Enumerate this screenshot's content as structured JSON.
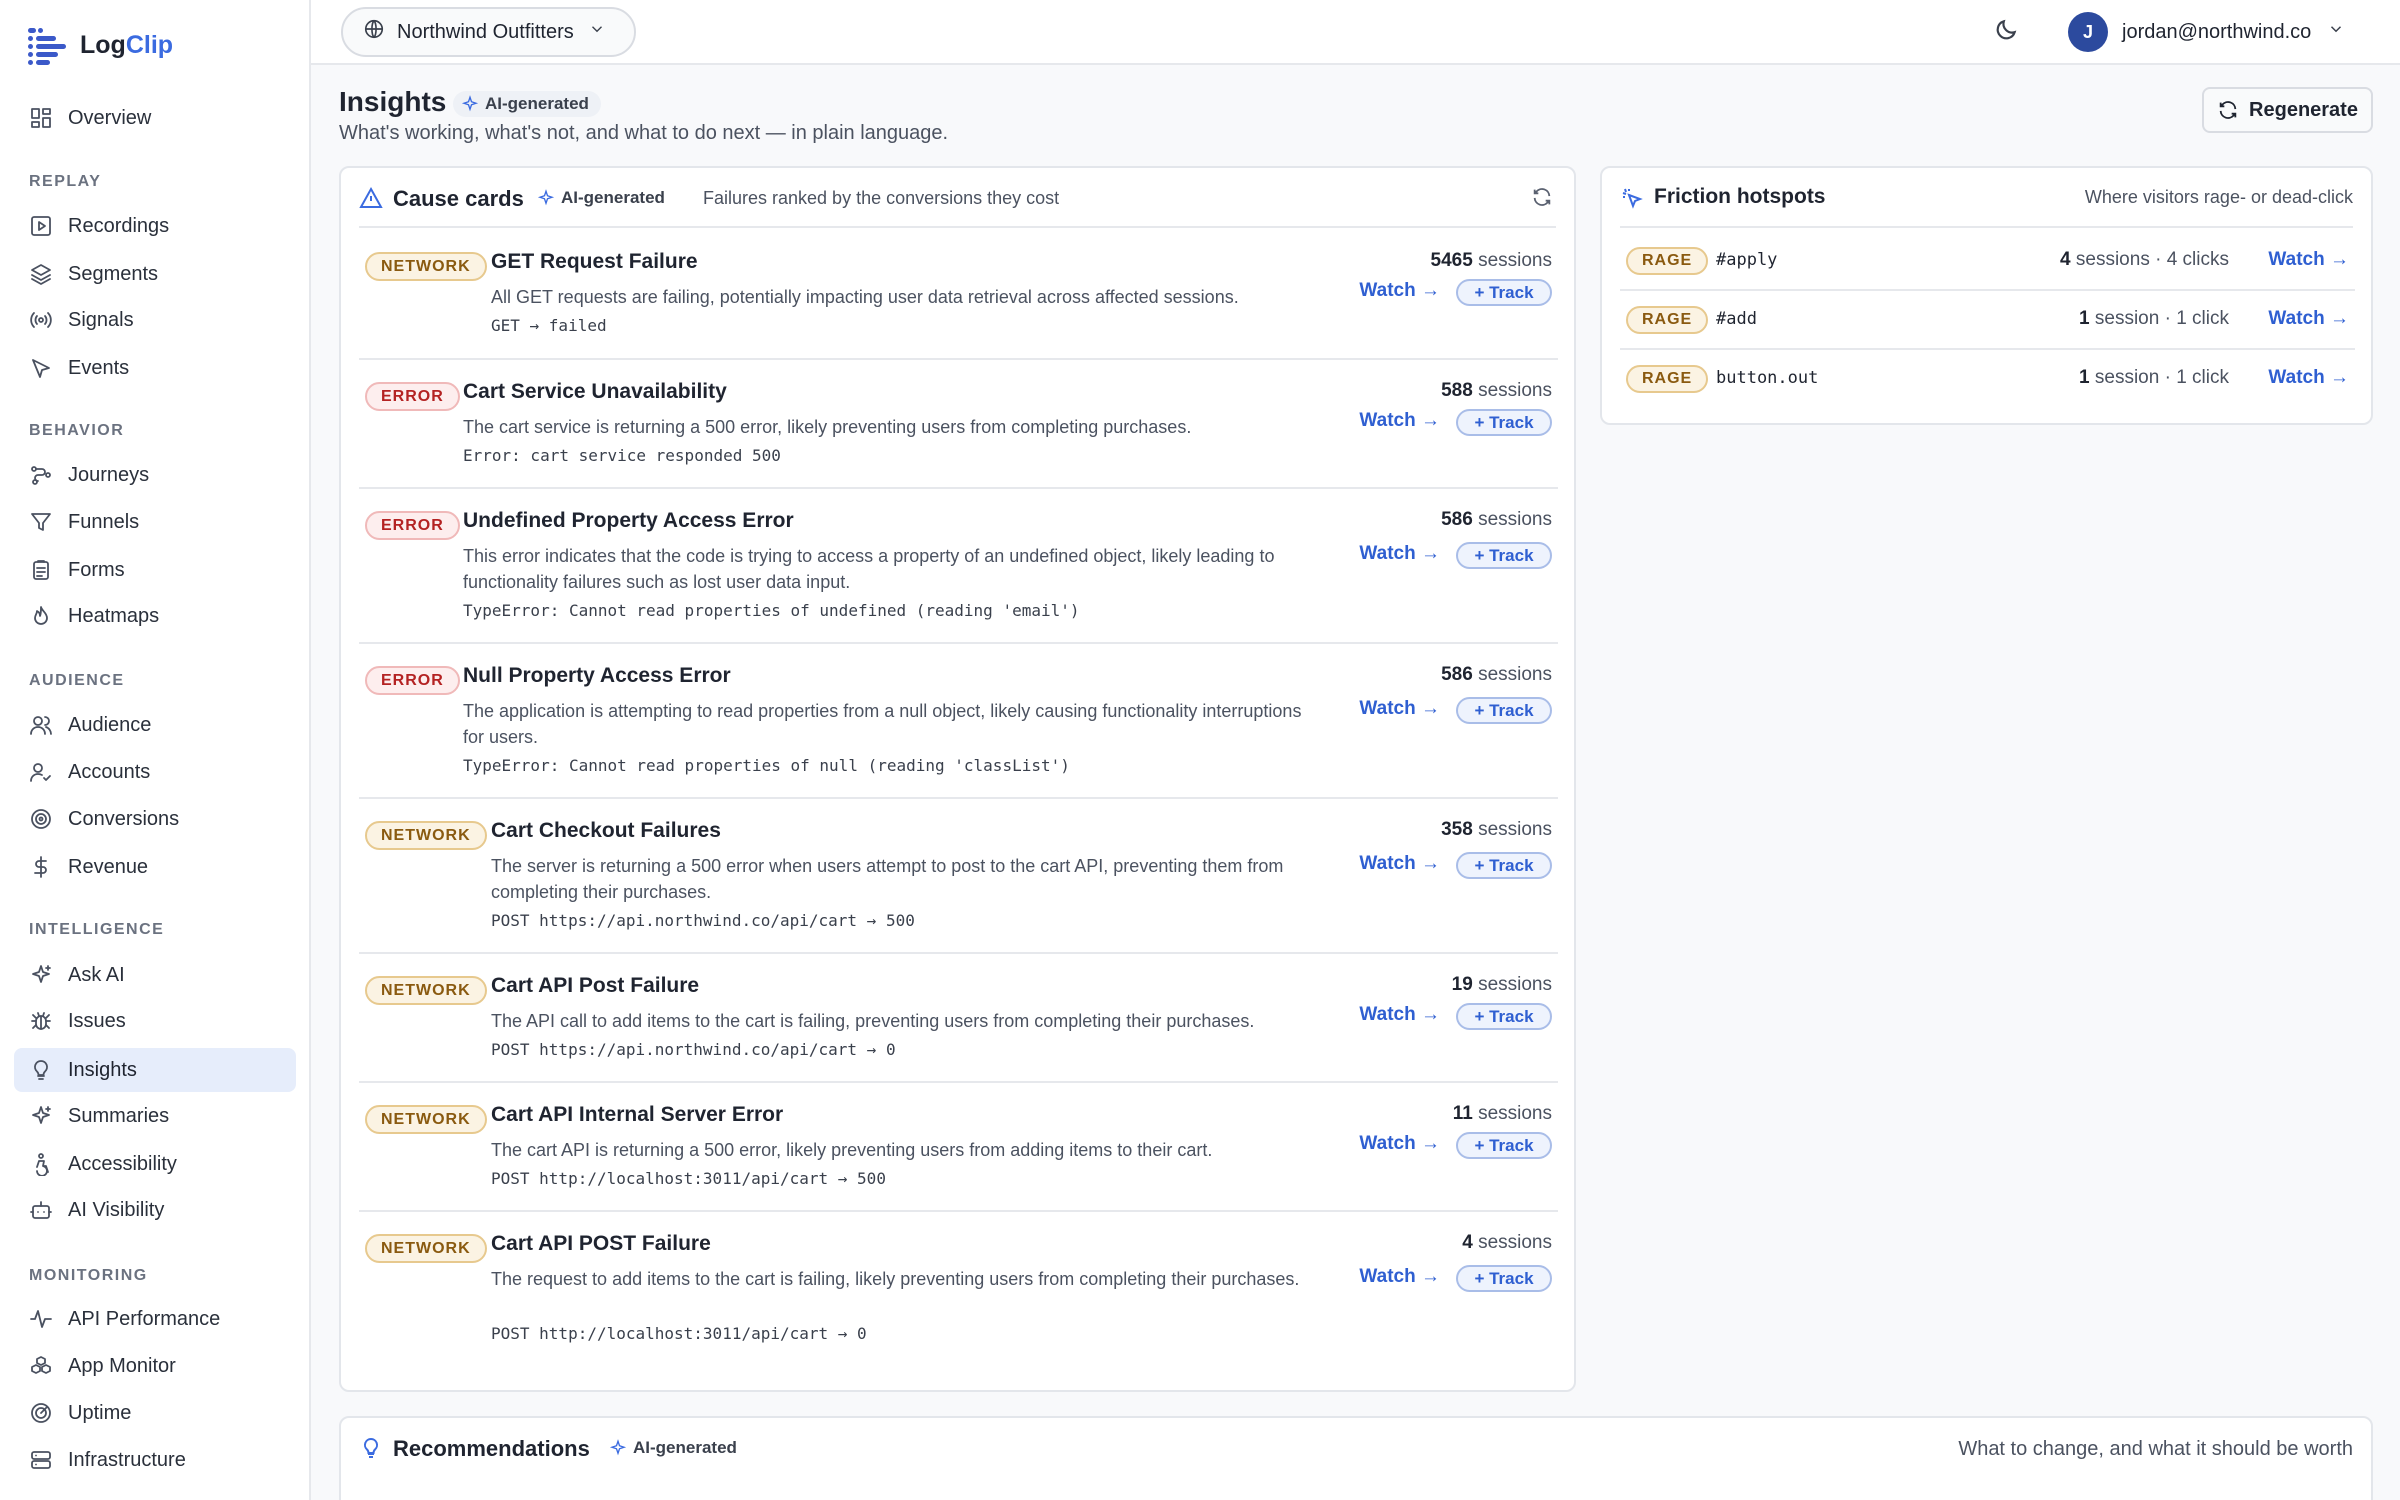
{
  "app": {
    "logo_left": "Log",
    "logo_right": "Clip"
  },
  "nav": {
    "overview": "Overview",
    "sections": {
      "replay": "REPLAY",
      "behavior": "BEHAVIOR",
      "audience": "AUDIENCE",
      "intelligence": "INTELLIGENCE",
      "monitoring": "MONITORING"
    },
    "replay": [
      "Recordings",
      "Segments",
      "Signals",
      "Events"
    ],
    "behavior": [
      "Journeys",
      "Funnels",
      "Forms",
      "Heatmaps"
    ],
    "audience": [
      "Audience",
      "Accounts",
      "Conversions",
      "Revenue"
    ],
    "intelligence": [
      "Ask AI",
      "Issues",
      "Insights",
      "Summaries",
      "Accessibility",
      "AI Visibility"
    ],
    "monitoring": [
      "API Performance",
      "App Monitor",
      "Uptime",
      "Infrastructure"
    ],
    "active": "Insights"
  },
  "topbar": {
    "workspace": "Northwind Outfitters",
    "user_initial": "J",
    "user_email": "jordan@northwind.co"
  },
  "header": {
    "title": "Insights",
    "badge": "AI-generated",
    "subtitle": "What's working, what's not, and what to do next — in plain language.",
    "regenerate": "Regenerate"
  },
  "cause_cards": {
    "title": "Cause cards",
    "badge": "AI-generated",
    "description": "Failures ranked by the conversions they cost",
    "watch_label": "Watch →",
    "track_label": "+ Track",
    "sessions_word": "sessions",
    "rows": [
      {
        "tag": "NETWORK",
        "title": "GET Request Failure",
        "desc": "All GET requests are failing, potentially impacting user data retrieval across affected sessions.",
        "code": "GET → failed",
        "count": "5465"
      },
      {
        "tag": "ERROR",
        "title": "Cart Service Unavailability",
        "desc": "The cart service is returning a 500 error, likely preventing users from completing purchases.",
        "code": "Error: cart service responded 500",
        "count": "588"
      },
      {
        "tag": "ERROR",
        "title": "Undefined Property Access Error",
        "desc": "This error indicates that the code is trying to access a property of an undefined object, likely leading to functionality failures such as lost user data input.",
        "code": "TypeError: Cannot read properties of undefined (reading 'email')",
        "count": "586"
      },
      {
        "tag": "ERROR",
        "title": "Null Property Access Error",
        "desc": "The application is attempting to read properties from a null object, likely causing functionality interruptions for users.",
        "code": "TypeError: Cannot read properties of null (reading 'classList')",
        "count": "586"
      },
      {
        "tag": "NETWORK",
        "title": "Cart Checkout Failures",
        "desc": "The server is returning a 500 error when users attempt to post to the cart API, preventing them from completing their purchases.",
        "code": "POST https://api.northwind.co/api/cart → 500",
        "count": "358"
      },
      {
        "tag": "NETWORK",
        "title": "Cart API Post Failure",
        "desc": "The API call to add items to the cart is failing, preventing users from completing their purchases.",
        "code": "POST https://api.northwind.co/api/cart → 0",
        "count": "19"
      },
      {
        "tag": "NETWORK",
        "title": "Cart API Internal Server Error",
        "desc": "The cart API is returning a 500 error, likely preventing users from adding items to their cart.",
        "code": "POST http://localhost:3011/api/cart → 500",
        "count": "11"
      },
      {
        "tag": "NETWORK",
        "title": "Cart API POST Failure",
        "desc": "The request to add items to the cart is failing, likely preventing users from completing their purchases.",
        "code": "POST http://localhost:3011/api/cart → 0",
        "count": "4"
      }
    ]
  },
  "friction": {
    "title": "Friction hotspots",
    "description": "Where visitors rage- or dead-click",
    "watch_label": "Watch →",
    "rows": [
      {
        "tag": "RAGE",
        "selector": "#apply",
        "sessions": "4",
        "sessions_word": "sessions",
        "clicks": "· 4 clicks"
      },
      {
        "tag": "RAGE",
        "selector": "#add",
        "sessions": "1",
        "sessions_word": "session",
        "clicks": "· 1 click"
      },
      {
        "tag": "RAGE",
        "selector": "button.out",
        "sessions": "1",
        "sessions_word": "session",
        "clicks": "· 1 click"
      }
    ]
  },
  "recommendations": {
    "title": "Recommendations",
    "badge": "AI-generated",
    "description": "What to change, and what it should be worth"
  }
}
